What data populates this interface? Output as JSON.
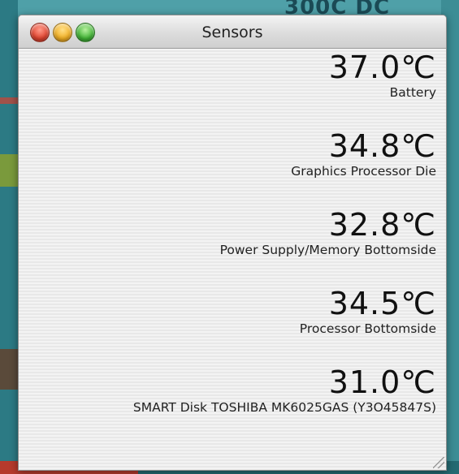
{
  "window": {
    "title": "Sensors"
  },
  "desktop": {
    "background_text": "300C DC"
  },
  "colors": {
    "close": "#e0442f",
    "minimize": "#f2b024",
    "zoom": "#42b536"
  },
  "sensors": [
    {
      "value": "37.0℃",
      "label": "Battery"
    },
    {
      "value": "34.8℃",
      "label": "Graphics Processor Die"
    },
    {
      "value": "32.8℃",
      "label": "Power Supply/Memory Bottomside"
    },
    {
      "value": "34.5℃",
      "label": "Processor Bottomside"
    },
    {
      "value": "31.0℃",
      "label": "SMART Disk TOSHIBA MK6025GAS (Y3O45847S)"
    }
  ]
}
